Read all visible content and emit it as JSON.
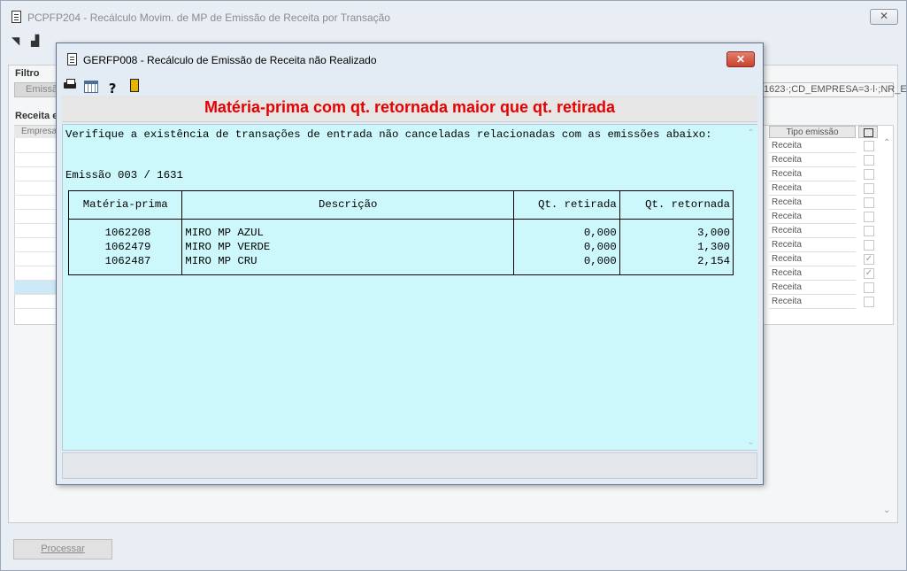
{
  "outer_window": {
    "title": "PCPFP204 - Recálculo Movim. de MP de Emissão de Receita por Transação",
    "close_label": "✕",
    "filter_group_label": "Filtro",
    "filter_tab_label": "Emissã",
    "filter_text": "1623·;CD_EMPRESA=3·l·;NR_E",
    "grid_group_label": "Receita e",
    "grid_first_column": "Empresa",
    "grid_type_column": "Tipo emissão",
    "grid_rows": [
      {
        "type": "Receita",
        "checked": ""
      },
      {
        "type": "Receita",
        "checked": ""
      },
      {
        "type": "Receita",
        "checked": ""
      },
      {
        "type": "Receita",
        "checked": ""
      },
      {
        "type": "Receita",
        "checked": ""
      },
      {
        "type": "Receita",
        "checked": ""
      },
      {
        "type": "Receita",
        "checked": ""
      },
      {
        "type": "Receita",
        "checked": ""
      },
      {
        "type": "Receita",
        "checked": "✓"
      },
      {
        "type": "Receita",
        "checked": "✓"
      },
      {
        "type": "Receita",
        "checked": ""
      },
      {
        "type": "Receita",
        "checked": ""
      }
    ],
    "process_button": "Processar"
  },
  "modal": {
    "title": "GERFP008 - Recálculo de Emissão de Receita não Realizado",
    "close_label": "✕",
    "heading": "Matéria-prima com qt. retornada maior que qt. retirada",
    "message": "Verifique a existência de transações de entrada não canceladas relacionadas com as emissões abaixo:",
    "emission": "Emissão 003 / 1631",
    "table": {
      "headers": [
        "Matéria-prima",
        "Descrição",
        "Qt. retirada",
        "Qt. retornada"
      ],
      "rows": [
        {
          "material": "1062208",
          "description": "MIRO MP AZUL",
          "withdrawn": "0,000",
          "returned": "3,000"
        },
        {
          "material": "1062479",
          "description": "MIRO MP VERDE",
          "withdrawn": "0,000",
          "returned": "1,300"
        },
        {
          "material": "1062487",
          "description": "MIRO MP CRU",
          "withdrawn": "0,000",
          "returned": "2,154"
        }
      ]
    }
  },
  "colors": {
    "heading_red": "#e60000",
    "report_background": "#ccf7fb",
    "modal_close_red": "#c9412c"
  },
  "icons": [
    "document-icon",
    "printer-icon",
    "calculator-icon",
    "help-icon",
    "exit-door-icon"
  ]
}
